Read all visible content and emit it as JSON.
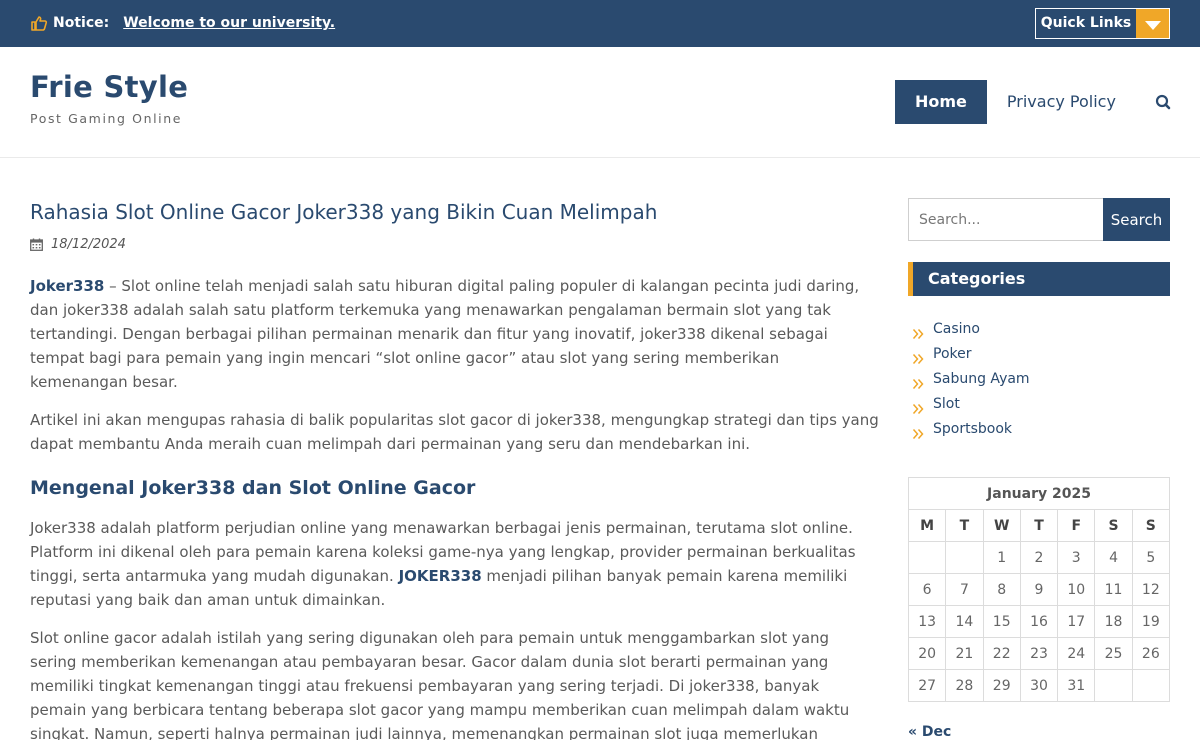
{
  "topbar": {
    "notice_label": "Notice:",
    "notice_text": "Welcome to our university.",
    "quick_links": "Quick Links"
  },
  "header": {
    "site_title": "Frie Style",
    "tagline": "Post Gaming Online",
    "nav": [
      {
        "label": "Home",
        "active": true
      },
      {
        "label": "Privacy Policy",
        "active": false
      }
    ]
  },
  "post": {
    "title": "Rahasia Slot Online Gacor Joker338 yang Bikin Cuan Melimpah",
    "date": "18/12/2024",
    "p1_link": "Joker338",
    "p1_text": " – Slot online telah menjadi salah satu hiburan digital paling populer di kalangan pecinta judi daring, dan joker338 adalah salah satu platform terkemuka yang menawarkan pengalaman bermain slot yang tak tertandingi. Dengan berbagai pilihan permainan menarik dan fitur yang inovatif, joker338 dikenal sebagai tempat bagi para pemain yang ingin mencari “slot online gacor” atau slot yang sering memberikan kemenangan besar.",
    "p2": "Artikel ini akan mengupas rahasia di balik popularitas slot gacor di joker338, mengungkap strategi dan tips yang dapat membantu Anda meraih cuan melimpah dari permainan yang seru dan mendebarkan ini.",
    "h2": "Mengenal Joker338 dan Slot Online Gacor",
    "p3_a": "Joker338 adalah platform perjudian online yang menawarkan berbagai jenis permainan, terutama slot online. Platform ini dikenal oleh para pemain karena koleksi game-nya yang lengkap, provider permainan berkualitas tinggi, serta antarmuka yang mudah digunakan. ",
    "p3_link": "JOKER338",
    "p3_b": " menjadi pilihan banyak pemain karena memiliki reputasi yang baik dan aman untuk dimainkan.",
    "p4": "Slot online gacor adalah istilah yang sering digunakan oleh para pemain untuk menggambarkan slot yang sering memberikan kemenangan atau pembayaran besar. Gacor dalam dunia slot berarti permainan yang memiliki tingkat kemenangan tinggi atau frekuensi pembayaran yang sering terjadi. Di joker338, banyak pemain yang berbicara tentang beberapa slot gacor yang mampu memberikan cuan melimpah dalam waktu singkat. Namun, seperti halnya permainan judi lainnya, memenangkan permainan slot juga memerlukan pengetahuan, strategi yang tepat, dan keberuntungan."
  },
  "sidebar": {
    "search_placeholder": "Search...",
    "search_button": "Search",
    "categories_title": "Categories",
    "categories": [
      "Casino",
      "Poker",
      "Sabung Ayam",
      "Slot",
      "Sportsbook"
    ],
    "calendar": {
      "caption": "January 2025",
      "days": [
        "M",
        "T",
        "W",
        "T",
        "F",
        "S",
        "S"
      ],
      "weeks": [
        [
          "",
          "",
          "1",
          "2",
          "3",
          "4",
          "5"
        ],
        [
          "6",
          "7",
          "8",
          "9",
          "10",
          "11",
          "12"
        ],
        [
          "13",
          "14",
          "15",
          "16",
          "17",
          "18",
          "19"
        ],
        [
          "20",
          "21",
          "22",
          "23",
          "24",
          "25",
          "26"
        ],
        [
          "27",
          "28",
          "29",
          "30",
          "31",
          "",
          ""
        ]
      ],
      "prev": "« Dec"
    }
  },
  "colors": {
    "primary": "#2a4a6f",
    "accent": "#f0a728"
  },
  "icons": {
    "notice": "thumbs-up-icon",
    "date": "calendar-icon",
    "search": "search-icon",
    "category": "double-chevron-right-icon"
  }
}
